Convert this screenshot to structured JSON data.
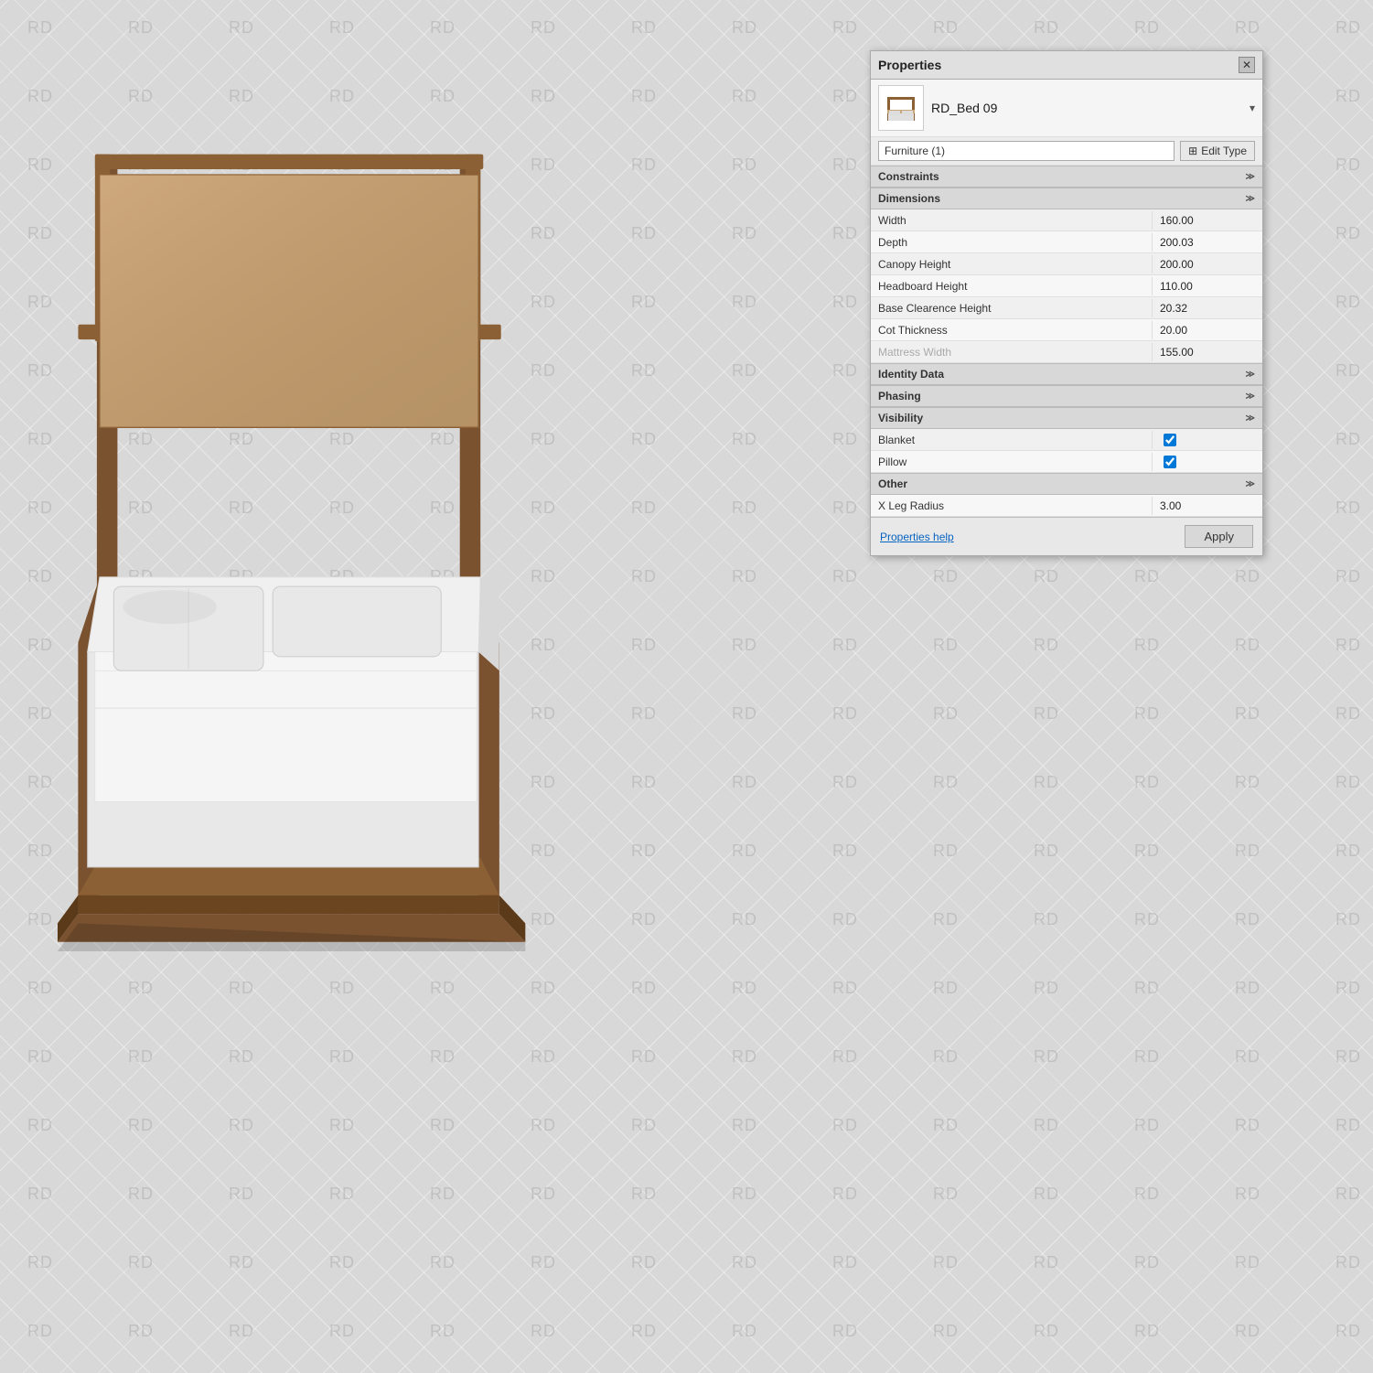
{
  "panel": {
    "title": "Properties",
    "close_label": "✕",
    "object": {
      "name": "RD_Bed 09",
      "dropdown_arrow": "▾"
    },
    "type_selector": {
      "label": "Furniture (1)",
      "edit_type_label": "Edit Type",
      "edit_type_icon": "⊞"
    },
    "sections": {
      "constraints": {
        "label": "Constraints",
        "arrow": "≫"
      },
      "dimensions": {
        "label": "Dimensions",
        "arrow": "≫",
        "properties": [
          {
            "name": "width-prop",
            "label": "Width",
            "value": "160.00",
            "greyed": false
          },
          {
            "name": "depth-prop",
            "label": "Depth",
            "value": "200.03",
            "greyed": false
          },
          {
            "name": "canopy-height-prop",
            "label": "Canopy Height",
            "value": "200.00",
            "greyed": false
          },
          {
            "name": "headboard-height-prop",
            "label": "Headboard Height",
            "value": "110.00",
            "greyed": false
          },
          {
            "name": "base-clearence-prop",
            "label": "Base Clearence Height",
            "value": "20.32",
            "greyed": false
          },
          {
            "name": "cot-thickness-prop",
            "label": "Cot Thickness",
            "value": "20.00",
            "greyed": false
          },
          {
            "name": "mattress-width-prop",
            "label": "Mattress Width",
            "value": "155.00",
            "greyed": true
          }
        ]
      },
      "identity_data": {
        "label": "Identity Data",
        "arrow": "≫"
      },
      "phasing": {
        "label": "Phasing",
        "arrow": "≫"
      },
      "visibility": {
        "label": "Visibility",
        "arrow": "≫",
        "properties": [
          {
            "name": "blanket-prop",
            "label": "Blanket",
            "checked": true
          },
          {
            "name": "pillow-prop",
            "label": "Pillow",
            "checked": true
          }
        ]
      },
      "other": {
        "label": "Other",
        "arrow": "≫",
        "properties": [
          {
            "name": "x-leg-radius-prop",
            "label": "X Leg Radius",
            "value": "3.00",
            "greyed": false
          }
        ]
      }
    },
    "footer": {
      "help_link": "Properties help",
      "apply_label": "Apply"
    }
  },
  "watermarks": [
    "RD",
    "RD",
    "RD",
    "RD",
    "RD",
    "RD",
    "RD",
    "RD",
    "RD",
    "RD",
    "RD",
    "RD",
    "RD",
    "RD",
    "RD",
    "RD",
    "RD",
    "RD",
    "RD",
    "RD",
    "RD",
    "RD",
    "RD",
    "RD",
    "RD",
    "RD",
    "RD",
    "RD",
    "RD",
    "RD"
  ]
}
